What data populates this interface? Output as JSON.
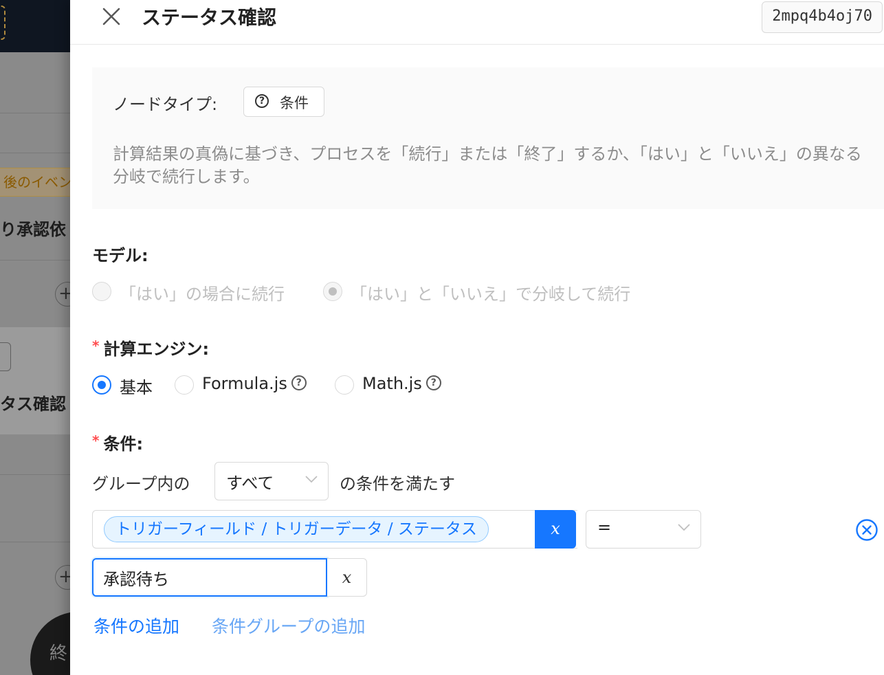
{
  "background": {
    "event_tag": "後のイベン",
    "approval_text": "り承認依",
    "status_text": "タス確認",
    "plus_symbol": "+",
    "end_node": "終"
  },
  "drawer": {
    "title": "ステータス確認",
    "node_id": "2mpq4b4oj70",
    "node_type_label": "ノードタイプ:",
    "node_type_value": "条件",
    "description": "計算結果の真偽に基づき、プロセスを「続行」または「終了」するか、「はい」と「いいえ」の異なる分岐で続行します。",
    "model": {
      "label": "モデル:",
      "options": [
        "「はい」の場合に続行",
        "「はい」と「いいえ」で分岐して続行"
      ],
      "selected": 1,
      "disabled": true
    },
    "engine": {
      "label": "計算エンジン:",
      "options": [
        "基本",
        "Formula.js",
        "Math.js"
      ],
      "selected": 0
    },
    "condition": {
      "label": "条件:",
      "group_prefix": "グループ内の",
      "group_select": "すべて",
      "group_suffix": "の条件を満たす",
      "field_tag": "トリガーフィールド / トリガーデータ / ステータス",
      "var_button": "x",
      "operator": "=",
      "value": "承認待ち",
      "value_var_button": "x"
    },
    "add_condition": "条件の追加",
    "add_group": "条件グループの追加"
  },
  "colors": {
    "primary": "#1677ff",
    "required": "#ff4d4f",
    "muted": "#8c8c8c"
  }
}
